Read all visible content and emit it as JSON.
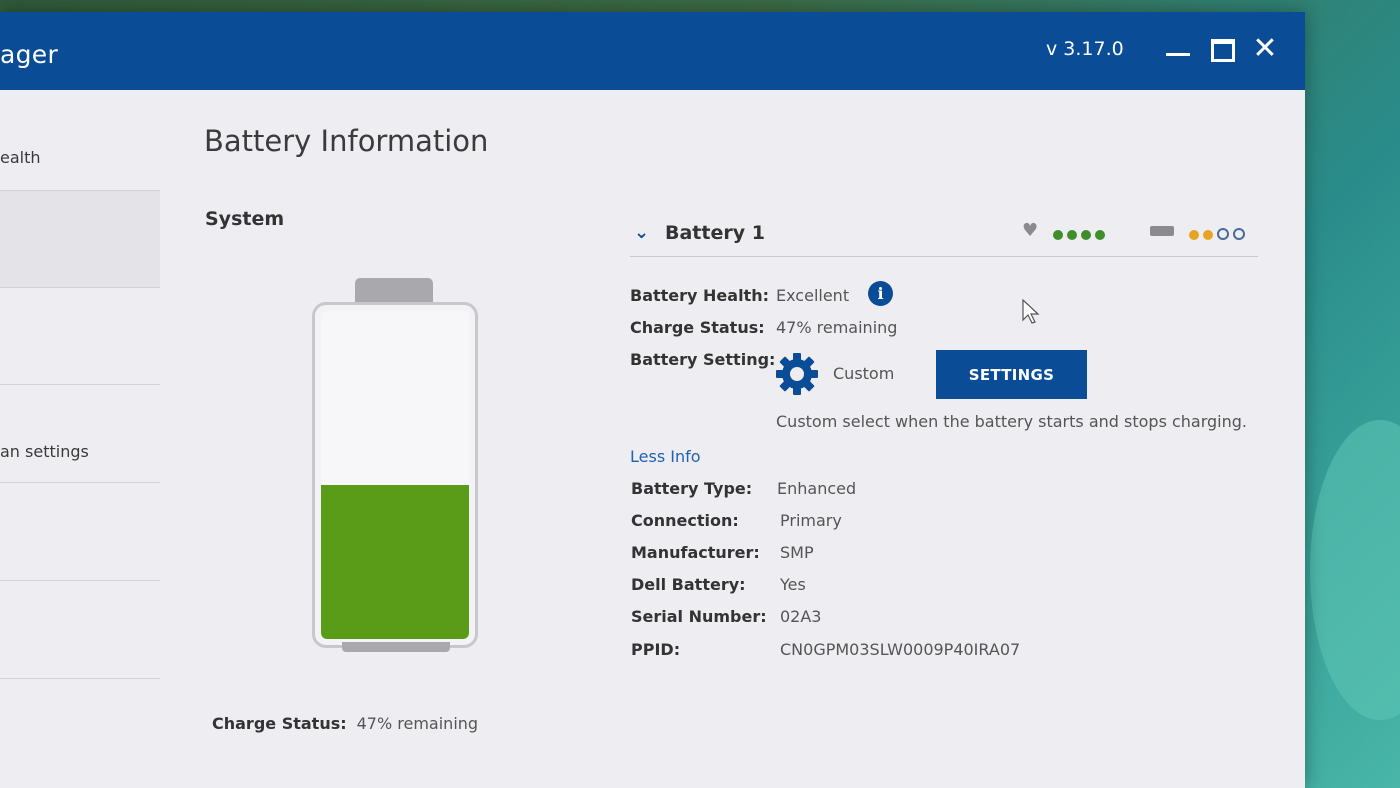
{
  "window": {
    "title_fragment": "ager",
    "version": "v 3.17.0"
  },
  "sidebar": {
    "items": [
      {
        "label": "ealth"
      },
      {
        "label": ""
      },
      {
        "label": ""
      },
      {
        "label": "an settings"
      },
      {
        "label": ""
      },
      {
        "label": ""
      }
    ]
  },
  "main": {
    "title": "Battery Information",
    "system": {
      "title": "System",
      "charge_label": "Charge Status:",
      "charge_value": "47% remaining",
      "charge_percent": 47
    },
    "battery1": {
      "name": "Battery 1",
      "health_dots": [
        "green",
        "green",
        "green",
        "green"
      ],
      "charge_dots": [
        "orange",
        "orange",
        "empty",
        "empty"
      ],
      "rows": {
        "health": {
          "label": "Battery Health:",
          "value": "Excellent"
        },
        "charge": {
          "label": "Charge Status:",
          "value": "47% remaining"
        },
        "setting": {
          "label": "Battery Setting:",
          "value": "Custom"
        }
      },
      "settings_button": "SETTINGS",
      "setting_description": "Custom select when the battery starts and stops charging.",
      "less_info": "Less Info",
      "details": [
        {
          "label": "Battery Type:",
          "value": "Enhanced"
        },
        {
          "label": "Connection:",
          "value": "Primary"
        },
        {
          "label": "Manufacturer:",
          "value": "SMP"
        },
        {
          "label": "Dell Battery:",
          "value": "Yes"
        },
        {
          "label": "Serial Number:",
          "value": "02A3"
        },
        {
          "label": "PPID:",
          "value": "CN0GPM03SLW0009P40IRA07"
        }
      ]
    }
  },
  "colors": {
    "titlebar": "#0a4c96",
    "battery_fill": "#5a9c18",
    "health_dot": "#3e8e2a",
    "charge_dot": "#e7a424"
  }
}
